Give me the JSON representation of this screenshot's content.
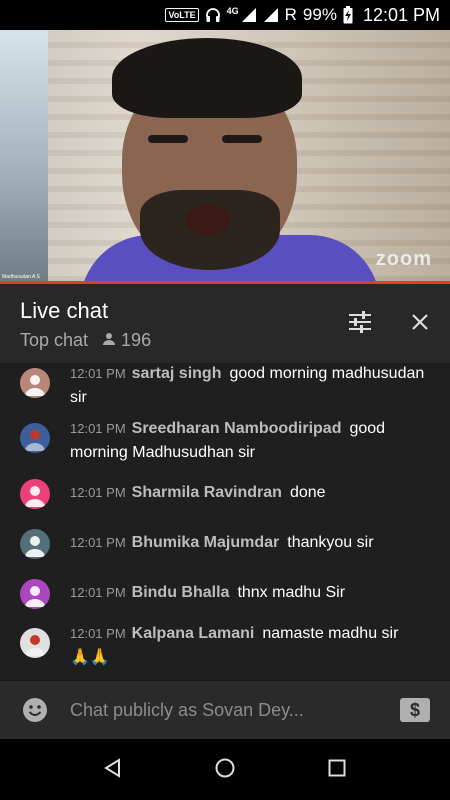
{
  "status_bar": {
    "volte": "VoLTE",
    "network": "4G",
    "carrier": "R",
    "battery": "99%",
    "time": "12:01 PM"
  },
  "video": {
    "overlay_brand": "zoom",
    "participant_label": "Madhusudan A S"
  },
  "chat_header": {
    "title": "Live chat",
    "mode": "Top chat",
    "viewer_count": "196"
  },
  "messages": [
    {
      "time": "12:01 PM",
      "author": "sartaj singh",
      "text": "good morning madhusudan sir",
      "avatar_color": "#b8877a",
      "avatar_type": "person"
    },
    {
      "time": "12:01 PM",
      "author": "Sreedharan Namboodiripad",
      "text": "good morning Madhusudhan sir",
      "avatar_color": "#3c5f9a",
      "avatar_type": "photo"
    },
    {
      "time": "12:01 PM",
      "author": "Sharmila Ravindran",
      "text": "done",
      "avatar_color": "#ec407a",
      "avatar_type": "person"
    },
    {
      "time": "12:01 PM",
      "author": "Bhumika Majumdar",
      "text": "thankyou sir",
      "avatar_color": "#546e7a",
      "avatar_type": "person"
    },
    {
      "time": "12:01 PM",
      "author": "Bindu Bhalla",
      "text": "thnx madhu Sir",
      "avatar_color": "#ab47bc",
      "avatar_type": "person"
    },
    {
      "time": "12:01 PM",
      "author": "Kalpana Lamani",
      "text": "namaste madhu sir",
      "emoji": "🙏🙏",
      "avatar_color": "#e0e0e0",
      "avatar_type": "photo"
    }
  ],
  "input": {
    "placeholder": "Chat publicly as Sovan Dey..."
  },
  "colors": {
    "accent_red": "#e53935",
    "header_bg": "#282828",
    "chat_bg": "#1f1f1f"
  },
  "icons": {
    "filter": "tune-icon",
    "close": "close-icon",
    "viewer": "person-icon",
    "emoji": "smiley-icon",
    "superchat": "dollar-icon"
  }
}
